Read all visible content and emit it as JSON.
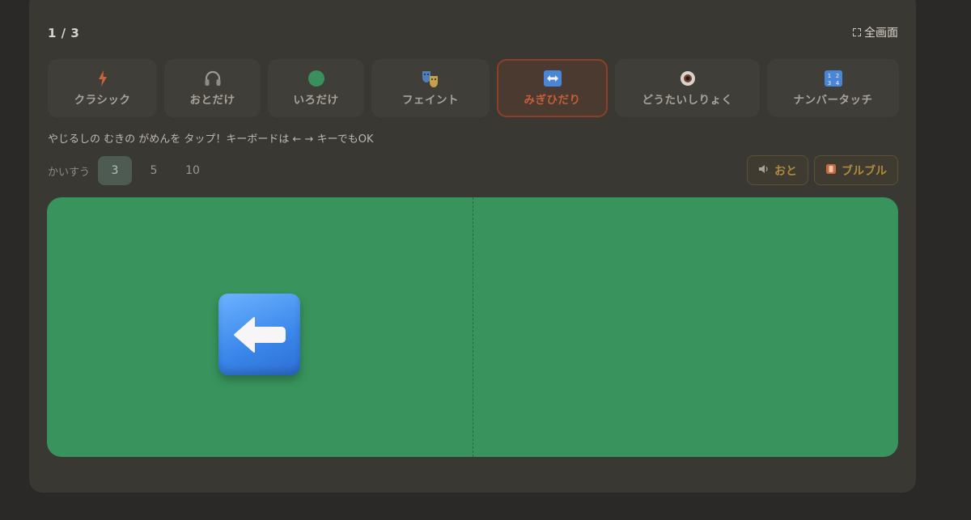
{
  "header": {
    "counter": "1 / 3",
    "fullscreen_label": "全画面"
  },
  "modes": [
    {
      "label": "クラシック",
      "icon": "lightning-icon"
    },
    {
      "label": "おとだけ",
      "icon": "headphones-icon"
    },
    {
      "label": "いろだけ",
      "icon": "green-circle-icon"
    },
    {
      "label": "フェイント",
      "icon": "theater-masks-icon"
    },
    {
      "label": "みぎひだり",
      "icon": "left-right-arrow-icon",
      "active": true
    },
    {
      "label": "どうたいしりょく",
      "icon": "eye-icon"
    },
    {
      "label": "ナンバータッチ",
      "icon": "numbers-icon"
    }
  ],
  "instruction": "やじるしの むきの がめんを タップ！キーボードは ← → キーでもOK",
  "rounds": {
    "label": "かいすう",
    "options": [
      "3",
      "5",
      "10"
    ],
    "selected": "3"
  },
  "toggles": {
    "sound_label": "おと",
    "vibrate_label": "ブルブル"
  },
  "stage": {
    "arrow_direction": "left",
    "arrow_icon": "left-arrow-icon",
    "colors": {
      "background": "#38935c",
      "arrow_box": "#3a86ea"
    }
  }
}
